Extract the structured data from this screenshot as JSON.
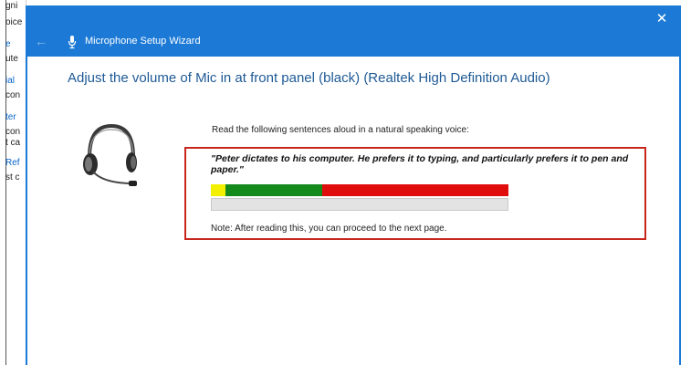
{
  "background_window": {
    "lines": [
      "gni",
      "oice",
      "e",
      "ute",
      "ial",
      "con",
      "ter",
      "con",
      "t ca",
      "Ref",
      "st c"
    ]
  },
  "wizard": {
    "title": "Microphone Setup Wizard",
    "heading": "Adjust the volume of Mic in at front panel (black) (Realtek High Definition Audio)",
    "instruction": "Read the following sentences aloud in a natural speaking voice:",
    "sentence": "\"Peter dictates to his computer. He prefers it to typing, and particularly prefers it to pen and paper.\"",
    "note": "Note: After reading this, you can proceed to the next page.",
    "close_glyph": "✕",
    "back_glyph": "←"
  },
  "volume_meter": {
    "yellow_fraction": 0.05,
    "green_fraction": 0.33,
    "red_fraction": 0.62,
    "input_level": 0
  },
  "colors": {
    "titlebar": "#1c7ad6",
    "heading": "#1e5a96",
    "highlight_border": "#c7261d"
  },
  "icons": {
    "title_icon": "microphone-icon",
    "illustration": "headset-icon"
  }
}
